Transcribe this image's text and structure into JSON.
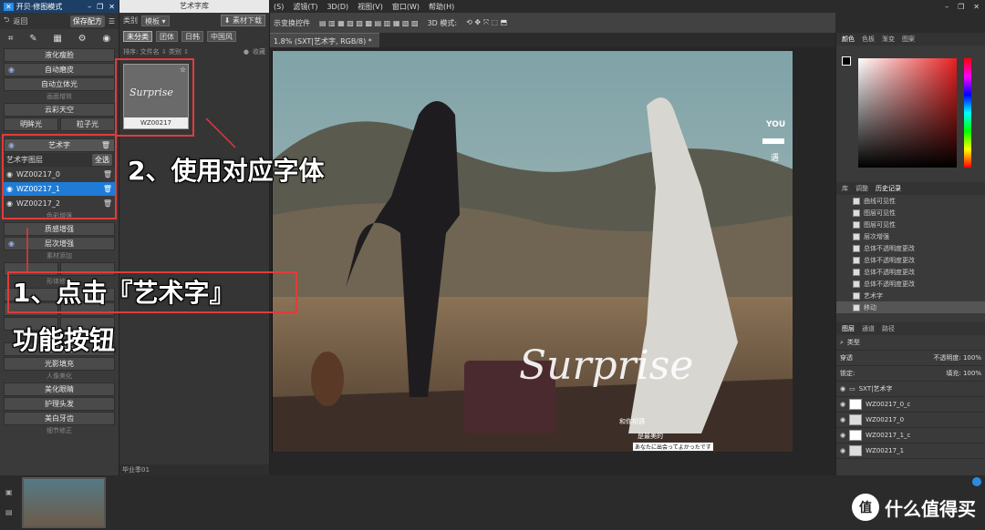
{
  "titlebar": {
    "title": "开贝·修图模式"
  },
  "menubar": {
    "items": [
      "(S)",
      "滤镜(T)",
      "3D(D)",
      "视图(V)",
      "窗口(W)",
      "帮助(H)"
    ]
  },
  "optbar": {
    "label": "示变换控件",
    "mode_label": "3D 模式:"
  },
  "doctab": {
    "label": "1.8% (SXT|艺术字, RGB/8) *"
  },
  "left_panel": {
    "back_label": "返回",
    "save_label": "保存配方",
    "rows": [
      {
        "label": "液化瘦脸",
        "eye": false
      },
      {
        "label": "自动磨皮",
        "eye": true
      },
      {
        "label": "自动立体光",
        "eye": false
      }
    ],
    "section_light": "画面增效",
    "sky_label": "云彩天空",
    "eyes_label": "明眸光",
    "particle_label": "粒子光",
    "arttext_label": "艺术字",
    "arttext_group": "艺术字图层",
    "all_label": "全选",
    "layers": [
      "WZ00217_0",
      "WZ00217_1",
      "WZ00217_2"
    ],
    "section_color": "色彩增强",
    "texture_label": "质感增强",
    "layer_enh_label": "层次增强",
    "section_material": "素材添加",
    "section_body": "形体修饰",
    "section_light2": "光影构造",
    "shadow_even": "光影均匀",
    "shadow_fill": "光影填充",
    "section_face": "人像美化",
    "brows": "美化眼睛",
    "hair": "护理头发",
    "teeth": "美白牙齿",
    "section_detail": "细节修正"
  },
  "art_panel": {
    "title": "艺术字库",
    "type_label": "类别",
    "type_value": "模板",
    "download_label": "素材下载",
    "chips": [
      "未分类",
      "团体",
      "日韩",
      "中国风"
    ],
    "sort_label": "排序: 文件名 ⇩ 类别 ⇩",
    "collect_label": "收藏",
    "thumb_script": "Surprise",
    "thumb_caption": "WZ00217",
    "footer": "毕业季01"
  },
  "photo": {
    "script": "Surprise",
    "you": "YOU",
    "tag": "遇",
    "caption1": "和你相遇",
    "caption2": "是最美的",
    "caption3": "あなたに出会ってよかったです"
  },
  "right_panel": {
    "tabs1": [
      "颜色",
      "色板",
      "渐变",
      "图案"
    ],
    "tabs2": [
      "库",
      "调整",
      "历史记录"
    ],
    "history": [
      "曲线可见性",
      "图层可见性",
      "图层可见性",
      "层次增强",
      "总体不透明度更改",
      "总体不透明度更改",
      "总体不透明度更改",
      "总体不透明度更改",
      "艺术字",
      "移动"
    ],
    "tabs3": [
      "图层",
      "通道",
      "路径"
    ],
    "kind_label": "类型",
    "blend_label": "穿透",
    "opacity_label": "不透明度: 100%",
    "lock_label": "锁定:",
    "fill_label": "填充: 100%",
    "layers": [
      "SXT|艺术字",
      "WZ00217_0_c",
      "WZ00217_0",
      "WZ00217_1_c",
      "WZ00217_1"
    ]
  },
  "annotations": {
    "step1": "1、点击『艺术字』",
    "step1b": "功能按钮",
    "step2": "2、使用对应字体"
  },
  "watermark": {
    "text": "什么值得买",
    "logo": "值"
  }
}
